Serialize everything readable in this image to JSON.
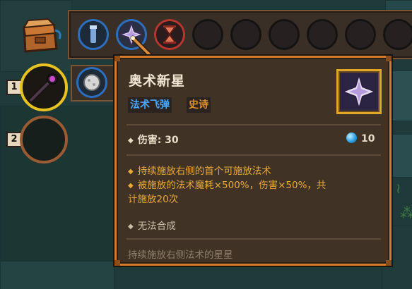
{
  "tooltip": {
    "title": "奥术新星",
    "tag_type": "法术飞弹",
    "tag_rarity": "史诗",
    "damage_label": "伤害: 30",
    "mana": "10",
    "effect_1": "持续施放右侧的首个可施放法术",
    "effect_2": "被施放的法术魔耗×500%，伤害×50%，共",
    "effect_2b": "计施放20次",
    "craft": "无法合成",
    "flavor": "持续施放右侧法术的星星"
  },
  "wands": [
    {
      "number": "1"
    },
    {
      "number": "2"
    }
  ],
  "icons": {
    "bag": "bag-icon",
    "slot_2": "arcane-nova-icon",
    "slot_1": "vial-icon",
    "slot_3": "hourglass-icon",
    "wand_1": "wand-icon",
    "orb": "stone-orb-icon",
    "mana": "mana-orb-icon"
  },
  "colors": {
    "tooltip_border": "#d77a2a",
    "tag_type": "#4aa8ff",
    "tag_rarity": "#e0902a",
    "effect_text": "#e8a93a",
    "active_wand": "#e8c21e"
  }
}
